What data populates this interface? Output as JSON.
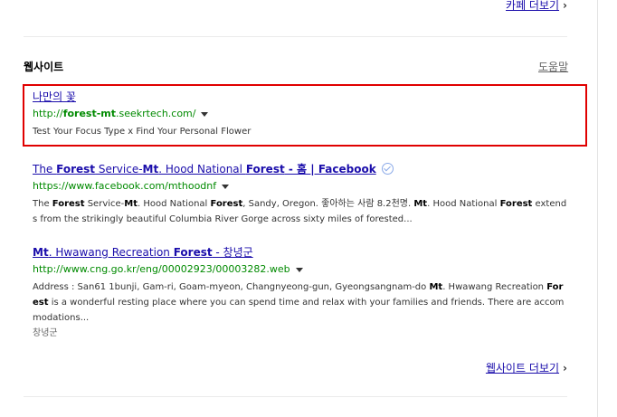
{
  "prev_section": {
    "more_label": "카페 더보기"
  },
  "website_section": {
    "title": "웹사이트",
    "help_label": "도움말",
    "more_label": "웹사이트 더보기"
  },
  "results": [
    {
      "title": "나만의 꽃",
      "url_parts": [
        "http://",
        "forest-mt",
        ".seekrtech.com/"
      ],
      "description": "Test Your Focus Type x Find Your Personal Flower"
    },
    {
      "title_parts": [
        "The ",
        "Forest",
        " Service-",
        "Mt",
        ". Hood National ",
        "Forest",
        " - 홈 | Facebook"
      ],
      "url": "https://www.facebook.com/mthoodnf",
      "verified_icon": "verified-check-icon",
      "description_parts": [
        "The ",
        "Forest",
        " Service-",
        "Mt",
        ". Hood National ",
        "Forest",
        ", Sandy, Oregon. 좋아하는 사람 8.2천명. ",
        "Mt",
        ". Hood National ",
        "Forest",
        " extends from the strikingly beautiful Columbia River Gorge across sixty miles of forested..."
      ]
    },
    {
      "title_parts": [
        "Mt",
        ". Hwawang Recreation ",
        "Forest",
        " - 창녕군"
      ],
      "url": "http://www.cng.go.kr/eng/00002923/00003282.web",
      "description_parts": [
        "Address : San61 1bunji, Gam-ri, Goam-myeon, Changnyeong-gun, Gyeongsangnam-do ",
        "Mt",
        ". Hwawang Recreation ",
        "Forest",
        " is a wonderful resting place where you can spend time and relax with your families and friends. There are accommodations..."
      ],
      "extra": "창녕군"
    }
  ],
  "colors": {
    "link": "#1a0dab",
    "url": "#008a00",
    "highlight_border": "#e00000"
  },
  "icons": {
    "dropdown": "caret-down-icon",
    "chevron": "chevron-right-icon"
  }
}
